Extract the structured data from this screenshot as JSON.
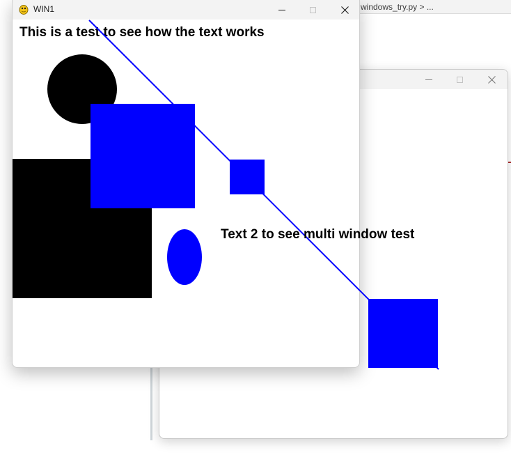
{
  "background_editor": {
    "breadcrumb": "windows_try.py > ..."
  },
  "window1": {
    "title": "WIN1",
    "text1": "This is a test to see how the text works",
    "controls": {
      "minimize": "minimize-icon",
      "maximize": "maximize-icon",
      "close": "close-icon"
    }
  },
  "window2": {
    "title": "",
    "text2": "Text 2 to see multi window test",
    "controls": {
      "minimize": "minimize-icon",
      "maximize": "maximize-icon",
      "close": "close-icon"
    }
  },
  "colors": {
    "blue": "#0000ff",
    "black": "#000000",
    "titlebar": "#f3f3f3"
  }
}
